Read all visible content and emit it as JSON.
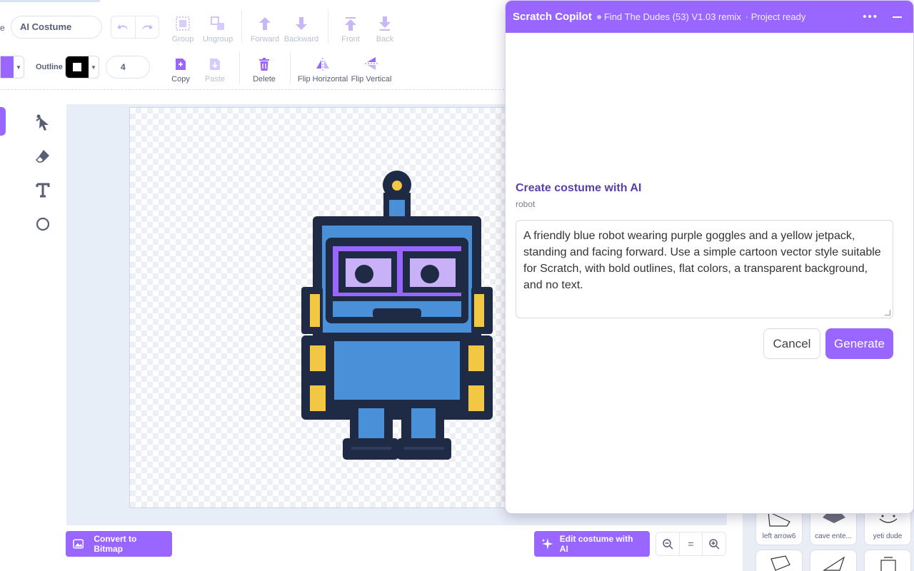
{
  "costume": {
    "name_label": "e",
    "name_value": "AI Costume"
  },
  "toolbar": {
    "group": "Group",
    "ungroup": "Ungroup",
    "forward": "Forward",
    "backward": "Backward",
    "front": "Front",
    "back": "Back",
    "copy": "Copy",
    "paste": "Paste",
    "delete": "Delete",
    "flip_horizontal": "Flip Horizontal",
    "flip_vertical": "Flip Vertical"
  },
  "style": {
    "outline_label": "Outline",
    "stroke_width": "4",
    "fill_color": "#9966ff",
    "outline_color": "#000000"
  },
  "bottom": {
    "convert_bitmap": "Convert to Bitmap",
    "edit_ai": "Edit costume with AI",
    "zoom_reset": "="
  },
  "costume_tiles": [
    {
      "label": "left arrow6"
    },
    {
      "label": "cave ente..."
    },
    {
      "label": "yeti dude"
    }
  ],
  "copilot": {
    "title": "Scratch Copilot",
    "project": "Find The Dudes (53) V1.03 remix",
    "status": "· Project ready",
    "menu": "•••",
    "create_title": "Create costume with AI",
    "create_subtitle": "robot",
    "prompt": "A friendly blue robot wearing purple goggles and a yellow jetpack, standing and facing forward. Use a simple cartoon vector style suitable for Scratch, with bold outlines, flat colors, a transparent background, and no text.",
    "cancel": "Cancel",
    "generate": "Generate"
  },
  "colors": {
    "accent": "#9966ff",
    "panel_heading": "#5a3fa6",
    "robot_body": "#4a90d9",
    "robot_goggles": "#9966ff",
    "robot_jetpack": "#f2c744",
    "robot_outline": "#1f2a44"
  }
}
